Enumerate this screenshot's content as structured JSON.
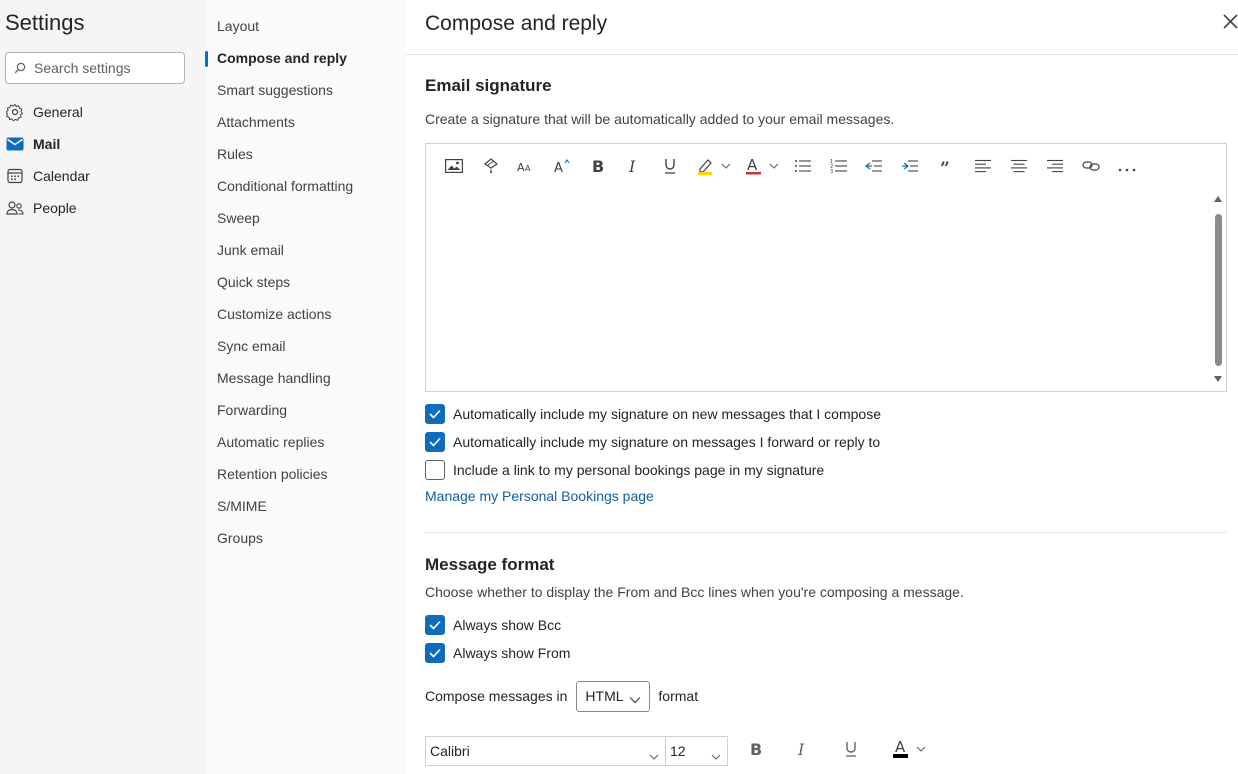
{
  "settings": {
    "title": "Settings",
    "search_placeholder": "Search settings",
    "categories": [
      {
        "label": "General",
        "icon": "gear-icon"
      },
      {
        "label": "Mail",
        "icon": "mail-icon"
      },
      {
        "label": "Calendar",
        "icon": "calendar-icon"
      },
      {
        "label": "People",
        "icon": "people-icon"
      }
    ]
  },
  "mail_nav": {
    "items": [
      {
        "label": "Layout"
      },
      {
        "label": "Compose and reply"
      },
      {
        "label": "Smart suggestions"
      },
      {
        "label": "Attachments"
      },
      {
        "label": "Rules"
      },
      {
        "label": "Conditional formatting"
      },
      {
        "label": "Sweep"
      },
      {
        "label": "Junk email"
      },
      {
        "label": "Quick steps"
      },
      {
        "label": "Customize actions"
      },
      {
        "label": "Sync email"
      },
      {
        "label": "Message handling"
      },
      {
        "label": "Forwarding"
      },
      {
        "label": "Automatic replies"
      },
      {
        "label": "Retention policies"
      },
      {
        "label": "S/MIME"
      },
      {
        "label": "Groups"
      }
    ]
  },
  "main": {
    "title": "Compose and reply",
    "signature": {
      "heading": "Email signature",
      "description": "Create a signature that will be automatically added to your email messages.",
      "toolbar_icons": [
        "insert-picture-icon",
        "format-painter-icon",
        "font-size-icon",
        "grow-font-icon",
        "bold-icon",
        "italic-icon",
        "underline-icon",
        "highlight-icon",
        "font-color-icon",
        "bullets-icon",
        "numbering-icon",
        "decrease-indent-icon",
        "increase-indent-icon",
        "quote-icon",
        "align-left-icon",
        "align-center-icon",
        "align-right-icon",
        "link-icon",
        "more-options-icon"
      ],
      "options": [
        {
          "label": "Automatically include my signature on new messages that I compose",
          "checked": true
        },
        {
          "label": "Automatically include my signature on messages I forward or reply to",
          "checked": true
        },
        {
          "label": "Include a link to my personal bookings page in my signature",
          "checked": false
        }
      ],
      "link": "Manage my Personal Bookings page"
    },
    "message_format": {
      "heading": "Message format",
      "description": "Choose whether to display the From and Bcc lines when you're composing a message.",
      "options": [
        {
          "label": "Always show Bcc",
          "checked": true
        },
        {
          "label": "Always show From",
          "checked": true
        }
      ],
      "compose_prefix": "Compose messages in",
      "compose_value": "HTML",
      "compose_suffix": "format",
      "font_family": "Calibri",
      "font_size": "12"
    }
  },
  "colors": {
    "accent": "#0f6cbd",
    "link": "#115ea3",
    "highlight": "#ffd700",
    "font_color": "#d13438"
  }
}
